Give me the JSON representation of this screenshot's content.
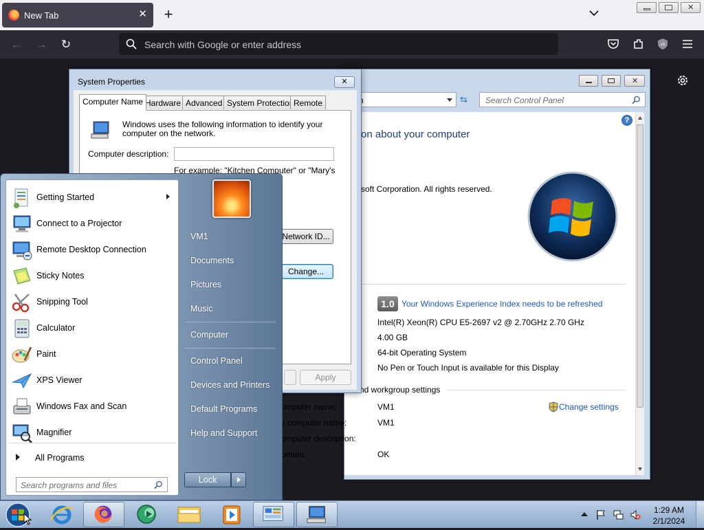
{
  "browser": {
    "tab_title": "New Tab",
    "address_placeholder": "Search with Google or enter address"
  },
  "control_panel": {
    "search_placeholder": "Search Control Panel",
    "heading_fragment": "on about your computer",
    "copyright_fragment": "soft Corporation.  All rights reserved.",
    "rating": "1.0",
    "rating_link": "Your Windows Experience Index needs to be refreshed",
    "system_rows": [
      {
        "label": "",
        "value": "Intel(R) Xeon(R) CPU E5-2697 v2 @ 2.70GHz   2.70 GHz"
      },
      {
        "label": ":",
        "value": "4.00 GB"
      },
      {
        "label": "",
        "value": "64-bit Operating System"
      },
      {
        "label": "",
        "value": "No Pen or Touch Input is available for this Display"
      }
    ],
    "section_title": "nd workgroup settings",
    "change_settings": "Change settings",
    "computer_rows": [
      {
        "label": "omputer name:",
        "value": "VM1"
      },
      {
        "label": "ll computer name:",
        "value": "VM1"
      },
      {
        "label": "omputer description:",
        "value": ""
      },
      {
        "label": "omain:",
        "value": "OK"
      }
    ]
  },
  "system_properties": {
    "title": "System Properties",
    "close_label": "✕",
    "tabs": [
      "Computer Name",
      "Hardware",
      "Advanced",
      "System Protection",
      "Remote"
    ],
    "info_text": "Windows uses the following information to identify your computer on the network.",
    "description_label": "Computer description:",
    "example_text": "For example: \"Kitchen Computer\" or \"Mary's",
    "network_id_button": "Network ID...",
    "change_button": "Change...",
    "apply_button": "Apply"
  },
  "start_menu": {
    "programs": [
      {
        "label": "Getting Started",
        "icon": "getting-started-icon",
        "has_submenu": true
      },
      {
        "label": "Connect to a Projector",
        "icon": "projector-icon"
      },
      {
        "label": "Remote Desktop Connection",
        "icon": "remote-desktop-icon"
      },
      {
        "label": "Sticky Notes",
        "icon": "sticky-notes-icon"
      },
      {
        "label": "Snipping Tool",
        "icon": "snipping-tool-icon"
      },
      {
        "label": "Calculator",
        "icon": "calculator-icon"
      },
      {
        "label": "Paint",
        "icon": "paint-icon"
      },
      {
        "label": "XPS Viewer",
        "icon": "xps-viewer-icon"
      },
      {
        "label": "Windows Fax and Scan",
        "icon": "fax-scan-icon"
      },
      {
        "label": "Magnifier",
        "icon": "magnifier-icon"
      }
    ],
    "all_programs": "All Programs",
    "search_placeholder": "Search programs and files",
    "right_items": [
      "VM1",
      "Documents",
      "Pictures",
      "Music",
      "Computer",
      "Control Panel",
      "Devices and Printers",
      "Default Programs",
      "Help and Support"
    ],
    "lock_label": "Lock"
  },
  "taskbar": {
    "time": "1:29 AM",
    "date": "2/1/2024"
  },
  "colors": {
    "accent_link": "#1e5bb8",
    "taskbar": "#a3bbd8",
    "firefox_toolbar": "#2b2a33"
  }
}
